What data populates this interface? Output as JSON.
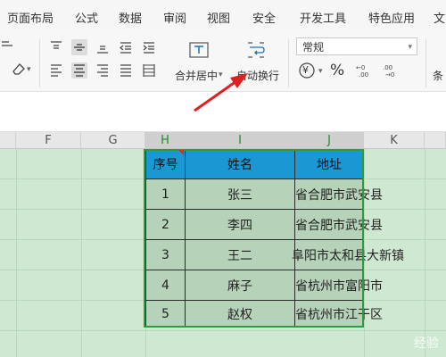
{
  "menu": {
    "items": [
      "页面布局",
      "公式",
      "数据",
      "审阅",
      "视图",
      "安全",
      "开发工具",
      "特色应用",
      "文"
    ]
  },
  "ribbon": {
    "merge_center_label": "合并居中",
    "wrap_text_label": "自动换行",
    "number_format_value": "常规",
    "currency_symbol": "¥",
    "percent_symbol": "%",
    "conditional_label": "条",
    "row2_label": "条"
  },
  "columns": [
    "F",
    "G",
    "H",
    "I",
    "J",
    "K"
  ],
  "table": {
    "headers": [
      "序号",
      "姓名",
      "地址"
    ],
    "rows": [
      {
        "no": "1",
        "name": "张三",
        "addr": "省合肥市武安县"
      },
      {
        "no": "2",
        "name": "李四",
        "addr": "省合肥市武安县"
      },
      {
        "no": "3",
        "name": "王二",
        "addr": "阜阳市太和县大新镇"
      },
      {
        "no": "4",
        "name": "麻子",
        "addr": "省杭州市富阳市"
      },
      {
        "no": "5",
        "name": "赵权",
        "addr": "省杭州市江干区"
      }
    ]
  },
  "watermark": "经验"
}
